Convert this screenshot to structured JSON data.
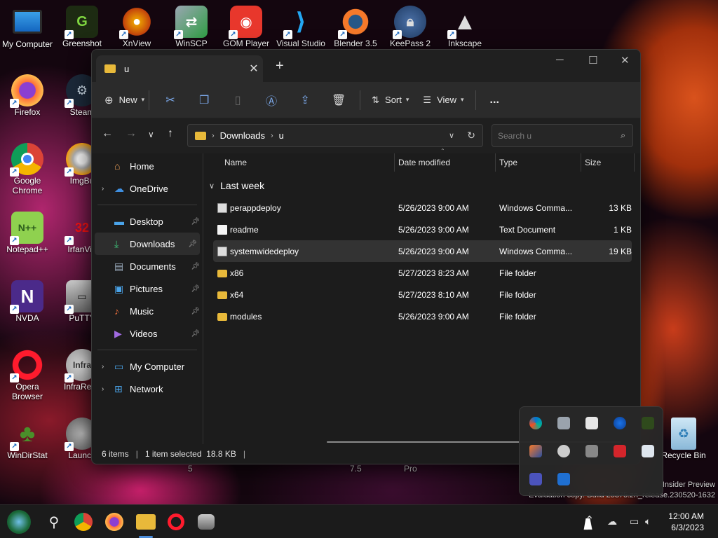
{
  "desktop": {
    "icons": [
      {
        "label": "My Computer"
      },
      {
        "label": "Greenshot"
      },
      {
        "label": "XnView"
      },
      {
        "label": "WinSCP"
      },
      {
        "label": "GOM Player"
      },
      {
        "label": "Visual Studio"
      },
      {
        "label": "Blender 3.5"
      },
      {
        "label": "KeePass 2"
      },
      {
        "label": "Inkscape"
      },
      {
        "label": "Firefox"
      },
      {
        "label": "Steam"
      },
      {
        "label": "Google Chrome"
      },
      {
        "label": "ImgBu"
      },
      {
        "label": "Notepad++"
      },
      {
        "label": "IrfanVie"
      },
      {
        "label": "NVDA"
      },
      {
        "label": "PuTTY"
      },
      {
        "label": "Opera Browser"
      },
      {
        "label": "InfraReco"
      },
      {
        "label": "WinDirStat"
      },
      {
        "label": "Launch"
      }
    ],
    "recycle_bin": "Recycle Bin",
    "watermark_line1": "Insider Preview",
    "watermark_line2": "Evaluation copy. Build 25375.zn_release.230520-1632",
    "behind_labels": [
      "5",
      "7.5",
      "Pro"
    ]
  },
  "explorer": {
    "tab_title": "u",
    "new_tab": "+",
    "toolbar": {
      "new": "New",
      "sort": "Sort",
      "view": "View",
      "more": "..."
    },
    "address": {
      "part1": "Downloads",
      "part2": "u"
    },
    "search": {
      "placeholder": "Search u"
    },
    "sidebar": {
      "home": "Home",
      "onedrive": "OneDrive",
      "desktop": "Desktop",
      "downloads": "Downloads",
      "documents": "Documents",
      "pictures": "Pictures",
      "music": "Music",
      "videos": "Videos",
      "mycomputer": "My Computer",
      "network": "Network"
    },
    "columns": {
      "name": "Name",
      "date": "Date modified",
      "type": "Type",
      "size": "Size"
    },
    "group": "Last week",
    "files": [
      {
        "name": "perappdeploy",
        "date": "5/26/2023 9:00 AM",
        "type": "Windows Comma...",
        "size": "13 KB",
        "icon": "cmd"
      },
      {
        "name": "readme",
        "date": "5/26/2023 9:00 AM",
        "type": "Text Document",
        "size": "1 KB",
        "icon": "txt"
      },
      {
        "name": "systemwidedeploy",
        "date": "5/26/2023 9:00 AM",
        "type": "Windows Comma...",
        "size": "19 KB",
        "icon": "cmd"
      },
      {
        "name": "x86",
        "date": "5/27/2023 8:23 AM",
        "type": "File folder",
        "size": "",
        "icon": "folder"
      },
      {
        "name": "x64",
        "date": "5/27/2023 8:10 AM",
        "type": "File folder",
        "size": "",
        "icon": "folder"
      },
      {
        "name": "modules",
        "date": "5/26/2023 9:00 AM",
        "type": "File folder",
        "size": "",
        "icon": "folder"
      }
    ],
    "status": {
      "count": "6 items",
      "selection": "1 item selected  18.8 KB"
    }
  },
  "taskbar": {
    "time": "12:00 AM",
    "date": "6/3/2023"
  },
  "colors": {
    "accent": "#4c8dd9",
    "folder": "#e8b93a",
    "window_bg": "#1c1c1c"
  }
}
